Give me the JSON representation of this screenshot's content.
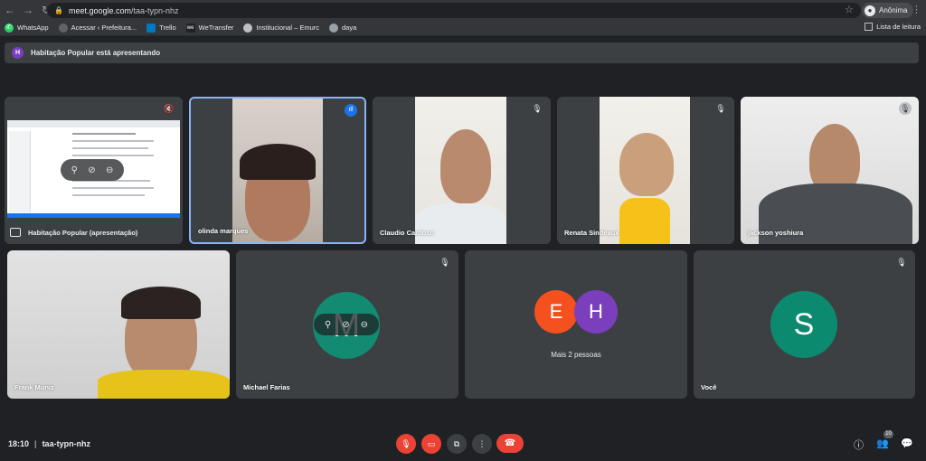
{
  "browser": {
    "url_host": "meet.google.com",
    "url_path": "/taa-typn-nhz",
    "profile_label": "Anônima",
    "bookmarks": [
      "WhatsApp",
      "Acessar ‹ Prefeitura...",
      "Trello",
      "WeTransfer",
      "Institucional – Emurc",
      "daya"
    ],
    "reading_list": "Lista de leitura"
  },
  "banner": {
    "avatar_letter": "H",
    "text": "Habitação Popular está apresentando"
  },
  "tiles": {
    "presentation": "Habitação Popular (apresentação)",
    "olinda": "olinda marques",
    "claudio": "Claudio Cardoso",
    "renata": "Renata Sindeaux",
    "jackson": "jackson yoshiura",
    "frank": "Frank Muniz",
    "michael": "Michael Farias",
    "michael_letter": "M",
    "more_letter_1": "E",
    "more_letter_2": "H",
    "more_label": "Mais 2 pessoas",
    "you": "Você",
    "you_letter": "S"
  },
  "footer": {
    "time": "18:10",
    "meeting_code": "taa-typn-nhz",
    "participants_count": "10"
  },
  "colors": {
    "michael_avatar": "#138a72",
    "e_avatar": "#f4511e",
    "h_avatar": "#7b3fbd",
    "s_avatar": "#0b8a6f",
    "speaking_border": "#8ab4f8"
  }
}
